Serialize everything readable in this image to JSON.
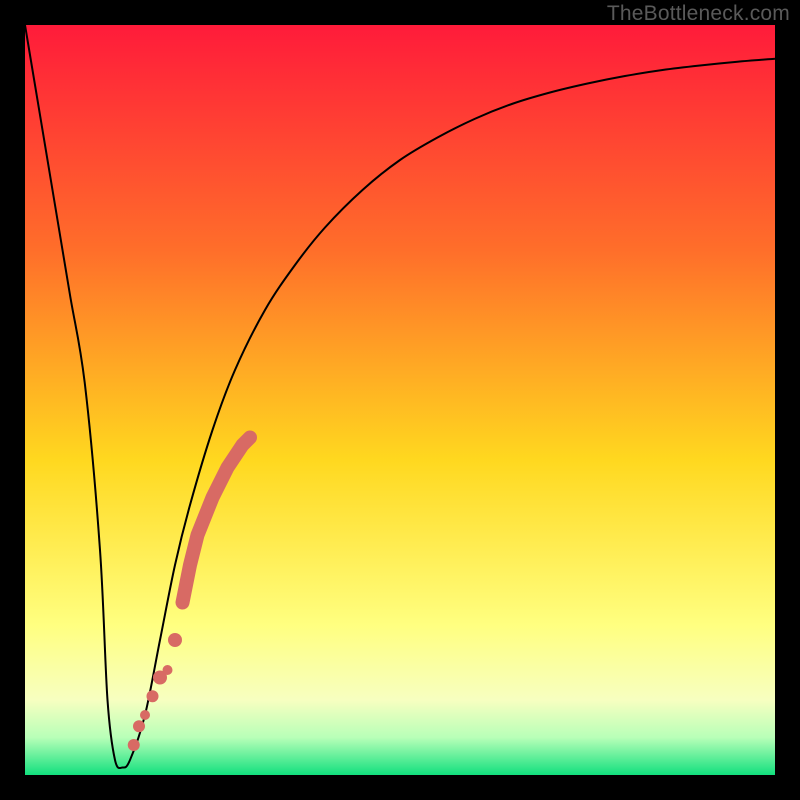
{
  "watermark": "TheBottleneck.com",
  "colors": {
    "frame": "#000000",
    "curve": "#000000",
    "dots": "#d86a64",
    "gradient_top": "#ff1b3a",
    "gradient_mid_upper": "#ff6e2a",
    "gradient_mid": "#ffd81f",
    "gradient_mid_light": "#ffff80",
    "gradient_mid_lower": "#f7ffc0",
    "gradient_low": "#b8ffb8",
    "gradient_bottom": "#12e07e"
  },
  "chart_data": {
    "type": "line",
    "title": "",
    "xlabel": "",
    "ylabel": "",
    "xlim": [
      0,
      100
    ],
    "ylim": [
      0,
      100
    ],
    "series": [
      {
        "name": "bottleneck-curve",
        "x": [
          0,
          2,
          4,
          6,
          8,
          10,
          11,
          12,
          13,
          14,
          16,
          18,
          20,
          22,
          25,
          28,
          32,
          36,
          40,
          45,
          50,
          55,
          60,
          65,
          70,
          75,
          80,
          85,
          90,
          95,
          100
        ],
        "y": [
          100,
          88,
          76,
          64,
          52,
          30,
          10,
          2,
          1,
          2,
          8,
          18,
          28,
          36,
          46,
          54,
          62,
          68,
          73,
          78,
          82,
          85,
          87.5,
          89.5,
          91,
          92.2,
          93.2,
          94,
          94.6,
          95.1,
          95.5
        ]
      }
    ],
    "highlight_points": {
      "name": "marked-segment",
      "x": [
        14.5,
        15.2,
        16.0,
        17.0,
        18.0,
        19.0,
        20.0,
        21.0,
        22.0,
        23.0,
        24.0,
        25.0,
        26.0,
        27.0,
        28.0,
        29.0,
        30.0
      ],
      "y": [
        4.0,
        6.5,
        8.0,
        10.5,
        13.0,
        14.0,
        18.0,
        23.0,
        28.0,
        32.0,
        34.5,
        37.0,
        39.0,
        41.0,
        42.5,
        44.0,
        45.0
      ]
    }
  }
}
